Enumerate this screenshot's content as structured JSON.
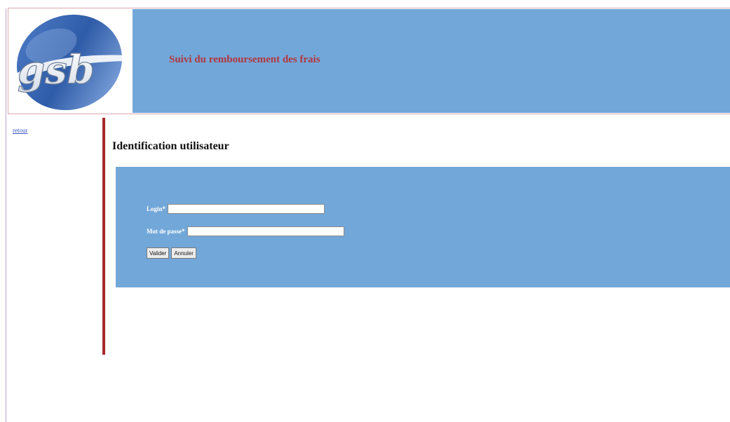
{
  "header": {
    "logo_text": "gsb",
    "title": "Suivi du remboursement des frais"
  },
  "sidebar": {
    "link_label": "retour"
  },
  "main": {
    "heading": "Identification utilisateur",
    "form": {
      "login_label": "Login*",
      "login_value": "",
      "password_label": "Mot de passe*",
      "password_value": "",
      "submit_label": "Valider",
      "reset_label": "Annuler"
    }
  },
  "colors": {
    "header_band": "#72a7d9",
    "title_text": "#b3373d",
    "sidebar_divider": "#a7282c",
    "panel": "#72a7d9"
  }
}
